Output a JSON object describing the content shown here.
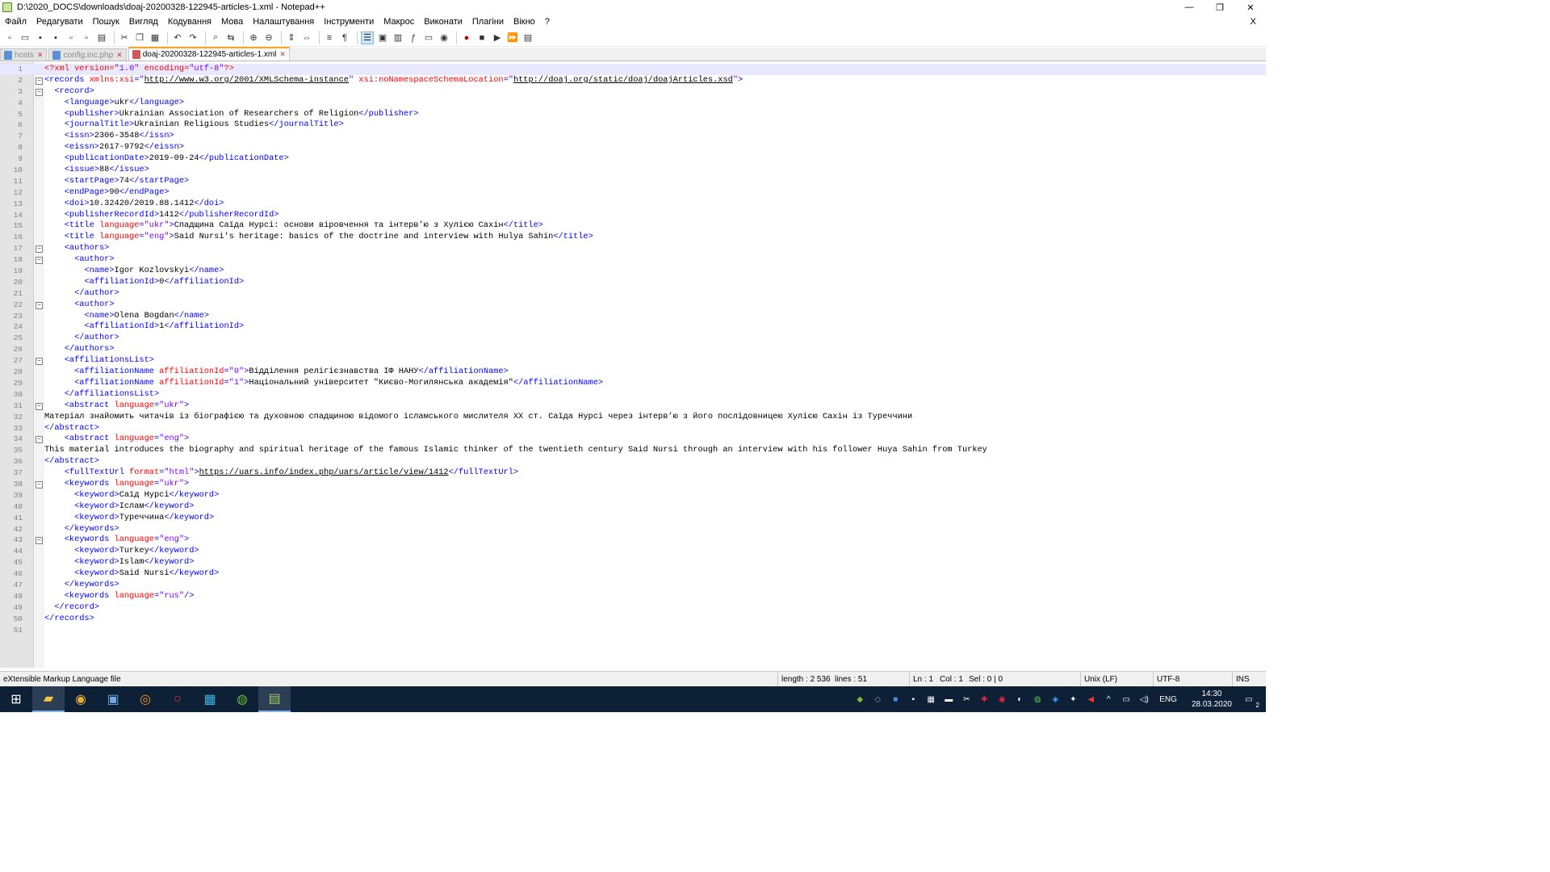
{
  "window": {
    "title": "D:\\2020_DOCS\\downloads\\doaj-20200328-122945-articles-1.xml - Notepad++",
    "minimize": "—",
    "restore": "❐",
    "close": "✕"
  },
  "menu": [
    "Файл",
    "Редагувати",
    "Пошук",
    "Вигляд",
    "Кодування",
    "Мова",
    "Налаштування",
    "Інструменти",
    "Макрос",
    "Виконати",
    "Плагіни",
    "Вікно",
    "?"
  ],
  "menu_close": "X",
  "tabs": [
    {
      "label": "hosts",
      "active": false,
      "modified": false
    },
    {
      "label": "config.inc.php",
      "active": false,
      "modified": false
    },
    {
      "label": "doaj-20200328-122945-articles-1.xml",
      "active": true,
      "modified": true
    }
  ],
  "tab_close": "✕",
  "editor": {
    "lines": [
      {
        "n": "1",
        "fold": "",
        "parts": [
          [
            "pi",
            "<?xml "
          ],
          [
            "a",
            "version"
          ],
          [
            "pi",
            "="
          ],
          [
            "v",
            "\"1.0\""
          ],
          [
            "pi",
            " "
          ],
          [
            "a",
            "encoding"
          ],
          [
            "pi",
            "="
          ],
          [
            "v",
            "\"utf-8\""
          ],
          [
            "pi",
            "?>"
          ]
        ]
      },
      {
        "n": "2",
        "fold": "-",
        "parts": [
          [
            "t",
            "<records "
          ],
          [
            "a",
            "xmlns:xsi"
          ],
          [
            "t",
            "="
          ],
          [
            "v",
            "\""
          ],
          [
            "u",
            "http://www.w3.org/2001/XMLSchema-instance"
          ],
          [
            "v",
            "\""
          ],
          [
            "t",
            " "
          ],
          [
            "a",
            "xsi:noNamespaceSchemaLocation"
          ],
          [
            "t",
            "="
          ],
          [
            "v",
            "\""
          ],
          [
            "u",
            "http://doaj.org/static/doaj/doajArticles.xsd"
          ],
          [
            "v",
            "\""
          ],
          [
            "t",
            ">"
          ]
        ]
      },
      {
        "n": "3",
        "fold": "-",
        "parts": [
          [
            "x",
            "  "
          ],
          [
            "t",
            "<record>"
          ]
        ]
      },
      {
        "n": "4",
        "fold": "",
        "parts": [
          [
            "x",
            "    "
          ],
          [
            "t",
            "<language>"
          ],
          [
            "x",
            "ukr"
          ],
          [
            "t",
            "</language>"
          ]
        ]
      },
      {
        "n": "5",
        "fold": "",
        "parts": [
          [
            "x",
            "    "
          ],
          [
            "t",
            "<publisher>"
          ],
          [
            "x",
            "Ukrainian Association of Researchers of Religion"
          ],
          [
            "t",
            "</publisher>"
          ]
        ]
      },
      {
        "n": "6",
        "fold": "",
        "parts": [
          [
            "x",
            "    "
          ],
          [
            "t",
            "<journalTitle>"
          ],
          [
            "x",
            "Ukrainian Religious Studies"
          ],
          [
            "t",
            "</journalTitle>"
          ]
        ]
      },
      {
        "n": "7",
        "fold": "",
        "parts": [
          [
            "x",
            "    "
          ],
          [
            "t",
            "<issn>"
          ],
          [
            "x",
            "2306-3548"
          ],
          [
            "t",
            "</issn>"
          ]
        ]
      },
      {
        "n": "8",
        "fold": "",
        "parts": [
          [
            "x",
            "    "
          ],
          [
            "t",
            "<eissn>"
          ],
          [
            "x",
            "2617-9792"
          ],
          [
            "t",
            "</eissn>"
          ]
        ]
      },
      {
        "n": "9",
        "fold": "",
        "parts": [
          [
            "x",
            "    "
          ],
          [
            "t",
            "<publicationDate>"
          ],
          [
            "x",
            "2019-09-24"
          ],
          [
            "t",
            "</publicationDate>"
          ]
        ]
      },
      {
        "n": "10",
        "fold": "",
        "parts": [
          [
            "x",
            "    "
          ],
          [
            "t",
            "<issue>"
          ],
          [
            "x",
            "88"
          ],
          [
            "t",
            "</issue>"
          ]
        ]
      },
      {
        "n": "11",
        "fold": "",
        "parts": [
          [
            "x",
            "    "
          ],
          [
            "t",
            "<startPage>"
          ],
          [
            "x",
            "74"
          ],
          [
            "t",
            "</startPage>"
          ]
        ]
      },
      {
        "n": "12",
        "fold": "",
        "parts": [
          [
            "x",
            "    "
          ],
          [
            "t",
            "<endPage>"
          ],
          [
            "x",
            "90"
          ],
          [
            "t",
            "</endPage>"
          ]
        ]
      },
      {
        "n": "13",
        "fold": "",
        "parts": [
          [
            "x",
            "    "
          ],
          [
            "t",
            "<doi>"
          ],
          [
            "x",
            "10.32420/2019.88.1412"
          ],
          [
            "t",
            "</doi>"
          ]
        ]
      },
      {
        "n": "14",
        "fold": "",
        "parts": [
          [
            "x",
            "    "
          ],
          [
            "t",
            "<publisherRecordId>"
          ],
          [
            "x",
            "1412"
          ],
          [
            "t",
            "</publisherRecordId>"
          ]
        ]
      },
      {
        "n": "15",
        "fold": "",
        "parts": [
          [
            "x",
            "    "
          ],
          [
            "t",
            "<title "
          ],
          [
            "a",
            "language"
          ],
          [
            "t",
            "="
          ],
          [
            "v",
            "\"ukr\""
          ],
          [
            "t",
            ">"
          ],
          [
            "x",
            "Спадщина Саїда Нурсі: основи віровчення та інтерв’ю з Хулією Сахін"
          ],
          [
            "t",
            "</title>"
          ]
        ]
      },
      {
        "n": "16",
        "fold": "",
        "parts": [
          [
            "x",
            "    "
          ],
          [
            "t",
            "<title "
          ],
          [
            "a",
            "language"
          ],
          [
            "t",
            "="
          ],
          [
            "v",
            "\"eng\""
          ],
          [
            "t",
            ">"
          ],
          [
            "x",
            "Said Nursi's heritage: basics of the doctrine and interview with Hulya Sahin"
          ],
          [
            "t",
            "</title>"
          ]
        ]
      },
      {
        "n": "17",
        "fold": "-",
        "parts": [
          [
            "x",
            "    "
          ],
          [
            "t",
            "<authors>"
          ]
        ]
      },
      {
        "n": "18",
        "fold": "-",
        "parts": [
          [
            "x",
            "      "
          ],
          [
            "t",
            "<author>"
          ]
        ]
      },
      {
        "n": "19",
        "fold": "",
        "parts": [
          [
            "x",
            "        "
          ],
          [
            "t",
            "<name>"
          ],
          [
            "x",
            "Igor Kozlovskyi"
          ],
          [
            "t",
            "</name>"
          ]
        ]
      },
      {
        "n": "20",
        "fold": "",
        "parts": [
          [
            "x",
            "        "
          ],
          [
            "t",
            "<affiliationId>"
          ],
          [
            "x",
            "0"
          ],
          [
            "t",
            "</affiliationId>"
          ]
        ]
      },
      {
        "n": "21",
        "fold": "",
        "parts": [
          [
            "x",
            "      "
          ],
          [
            "t",
            "</author>"
          ]
        ]
      },
      {
        "n": "22",
        "fold": "-",
        "parts": [
          [
            "x",
            "      "
          ],
          [
            "t",
            "<author>"
          ]
        ]
      },
      {
        "n": "23",
        "fold": "",
        "parts": [
          [
            "x",
            "        "
          ],
          [
            "t",
            "<name>"
          ],
          [
            "x",
            "Olena Bogdan"
          ],
          [
            "t",
            "</name>"
          ]
        ]
      },
      {
        "n": "24",
        "fold": "",
        "parts": [
          [
            "x",
            "        "
          ],
          [
            "t",
            "<affiliationId>"
          ],
          [
            "x",
            "1"
          ],
          [
            "t",
            "</affiliationId>"
          ]
        ]
      },
      {
        "n": "25",
        "fold": "",
        "parts": [
          [
            "x",
            "      "
          ],
          [
            "t",
            "</author>"
          ]
        ]
      },
      {
        "n": "26",
        "fold": "",
        "parts": [
          [
            "x",
            "    "
          ],
          [
            "t",
            "</authors>"
          ]
        ]
      },
      {
        "n": "27",
        "fold": "-",
        "parts": [
          [
            "x",
            "    "
          ],
          [
            "t",
            "<affiliationsList>"
          ]
        ]
      },
      {
        "n": "28",
        "fold": "",
        "parts": [
          [
            "x",
            "      "
          ],
          [
            "t",
            "<affiliationName "
          ],
          [
            "a",
            "affiliationId"
          ],
          [
            "t",
            "="
          ],
          [
            "v",
            "\"0\""
          ],
          [
            "t",
            ">"
          ],
          [
            "x",
            "Відділення релігієзнавства ІФ НАНУ"
          ],
          [
            "t",
            "</affiliationName>"
          ]
        ]
      },
      {
        "n": "29",
        "fold": "",
        "parts": [
          [
            "x",
            "      "
          ],
          [
            "t",
            "<affiliationName "
          ],
          [
            "a",
            "affiliationId"
          ],
          [
            "t",
            "="
          ],
          [
            "v",
            "\"1\""
          ],
          [
            "t",
            ">"
          ],
          [
            "x",
            "Національний університет \"Києво-Могилянська академія\""
          ],
          [
            "t",
            "</affiliationName>"
          ]
        ]
      },
      {
        "n": "30",
        "fold": "",
        "parts": [
          [
            "x",
            "    "
          ],
          [
            "t",
            "</affiliationsList>"
          ]
        ]
      },
      {
        "n": "31",
        "fold": "-",
        "parts": [
          [
            "x",
            "    "
          ],
          [
            "t",
            "<abstract "
          ],
          [
            "a",
            "language"
          ],
          [
            "t",
            "="
          ],
          [
            "v",
            "\"ukr\""
          ],
          [
            "t",
            ">"
          ]
        ]
      },
      {
        "n": "32",
        "fold": "",
        "parts": [
          [
            "x",
            "Матеріал знайомить читачів із біографією та духовною спадщиною відомого ісламського мислителя ХХ ст. Саїда Нурсі через інтерв’ю з його послідовницею Хулією Сахін із Туреччини"
          ]
        ]
      },
      {
        "n": "33",
        "fold": "",
        "parts": [
          [
            "t",
            "</abstract>"
          ]
        ]
      },
      {
        "n": "34",
        "fold": "-",
        "parts": [
          [
            "x",
            "    "
          ],
          [
            "t",
            "<abstract "
          ],
          [
            "a",
            "language"
          ],
          [
            "t",
            "="
          ],
          [
            "v",
            "\"eng\""
          ],
          [
            "t",
            ">"
          ]
        ]
      },
      {
        "n": "35",
        "fold": "",
        "parts": [
          [
            "x",
            "This material introduces the biography and spiritual heritage of the famous Islamic thinker of the twentieth century Said Nursi through an interview with his follower Huya Sahin from Turkey"
          ]
        ]
      },
      {
        "n": "36",
        "fold": "",
        "parts": [
          [
            "t",
            "</abstract>"
          ]
        ]
      },
      {
        "n": "37",
        "fold": "",
        "parts": [
          [
            "x",
            "    "
          ],
          [
            "t",
            "<fullTextUrl "
          ],
          [
            "a",
            "format"
          ],
          [
            "t",
            "="
          ],
          [
            "v",
            "\"html\""
          ],
          [
            "t",
            ">"
          ],
          [
            "u",
            "https://uars.info/index.php/uars/article/view/1412"
          ],
          [
            "t",
            "</fullTextUrl>"
          ]
        ]
      },
      {
        "n": "38",
        "fold": "-",
        "parts": [
          [
            "x",
            "    "
          ],
          [
            "t",
            "<keywords "
          ],
          [
            "a",
            "language"
          ],
          [
            "t",
            "="
          ],
          [
            "v",
            "\"ukr\""
          ],
          [
            "t",
            ">"
          ]
        ]
      },
      {
        "n": "39",
        "fold": "",
        "parts": [
          [
            "x",
            "      "
          ],
          [
            "t",
            "<keyword>"
          ],
          [
            "x",
            "Саїд Нурсі"
          ],
          [
            "t",
            "</keyword>"
          ]
        ]
      },
      {
        "n": "40",
        "fold": "",
        "parts": [
          [
            "x",
            "      "
          ],
          [
            "t",
            "<keyword>"
          ],
          [
            "x",
            "Іслам"
          ],
          [
            "t",
            "</keyword>"
          ]
        ]
      },
      {
        "n": "41",
        "fold": "",
        "parts": [
          [
            "x",
            "      "
          ],
          [
            "t",
            "<keyword>"
          ],
          [
            "x",
            "Туреччина"
          ],
          [
            "t",
            "</keyword>"
          ]
        ]
      },
      {
        "n": "42",
        "fold": "",
        "parts": [
          [
            "x",
            "    "
          ],
          [
            "t",
            "</keywords>"
          ]
        ]
      },
      {
        "n": "43",
        "fold": "-",
        "parts": [
          [
            "x",
            "    "
          ],
          [
            "t",
            "<keywords "
          ],
          [
            "a",
            "language"
          ],
          [
            "t",
            "="
          ],
          [
            "v",
            "\"eng\""
          ],
          [
            "t",
            ">"
          ]
        ]
      },
      {
        "n": "44",
        "fold": "",
        "parts": [
          [
            "x",
            "      "
          ],
          [
            "t",
            "<keyword>"
          ],
          [
            "x",
            "Turkey"
          ],
          [
            "t",
            "</keyword>"
          ]
        ]
      },
      {
        "n": "45",
        "fold": "",
        "parts": [
          [
            "x",
            "      "
          ],
          [
            "t",
            "<keyword>"
          ],
          [
            "x",
            "Islam"
          ],
          [
            "t",
            "</keyword>"
          ]
        ]
      },
      {
        "n": "46",
        "fold": "",
        "parts": [
          [
            "x",
            "      "
          ],
          [
            "t",
            "<keyword>"
          ],
          [
            "x",
            "Said Nursi"
          ],
          [
            "t",
            "</keyword>"
          ]
        ]
      },
      {
        "n": "47",
        "fold": "",
        "parts": [
          [
            "x",
            "    "
          ],
          [
            "t",
            "</keywords>"
          ]
        ]
      },
      {
        "n": "48",
        "fold": "",
        "parts": [
          [
            "x",
            "    "
          ],
          [
            "t",
            "<keywords "
          ],
          [
            "a",
            "language"
          ],
          [
            "t",
            "="
          ],
          [
            "v",
            "\"rus\""
          ],
          [
            "t",
            "/>"
          ]
        ]
      },
      {
        "n": "49",
        "fold": "",
        "parts": [
          [
            "x",
            "  "
          ],
          [
            "t",
            "</record>"
          ]
        ]
      },
      {
        "n": "50",
        "fold": "",
        "parts": [
          [
            "t",
            "</records>"
          ]
        ]
      },
      {
        "n": "51",
        "fold": "",
        "parts": []
      }
    ]
  },
  "status": {
    "file_type": "eXtensible Markup Language file",
    "length": "length : 2 536",
    "lines": "lines : 51",
    "ln": "Ln : 1",
    "col": "Col : 1",
    "sel": "Sel : 0 | 0",
    "eol": "Unix (LF)",
    "encoding": "UTF-8",
    "mode": "INS"
  },
  "taskbar": {
    "lang": "ENG",
    "time": "14:30",
    "date": "28.03.2020",
    "notifications": "2"
  },
  "colors": {
    "tag": "#0000ff",
    "attr": "#ff0000",
    "value": "#8000ff",
    "taskbar": "#0e2036"
  }
}
